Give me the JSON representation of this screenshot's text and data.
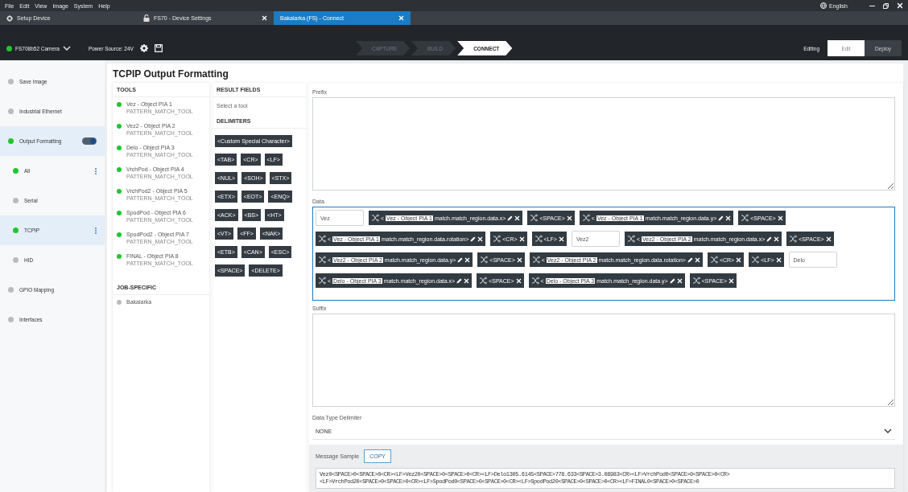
{
  "menu_bar": {
    "items": [
      "File",
      "Edit",
      "View",
      "Image",
      "System",
      "Help"
    ],
    "language": "English"
  },
  "tabs": [
    {
      "label": "Setup Device",
      "kind": "home",
      "closable": false,
      "selected": false
    },
    {
      "label": "FS70 - Device Settings",
      "kind": "lock",
      "closable": true,
      "selected": false
    },
    {
      "label": "Bakalarka (FS) - Connect",
      "kind": "plain",
      "closable": true,
      "selected": true
    }
  ],
  "toolbar": {
    "camera": "FS708b52 Camera",
    "power": "Power Source: 24V",
    "steps": [
      {
        "label": "CAPTURE",
        "selected": false
      },
      {
        "label": "BUILD",
        "selected": false
      },
      {
        "label": "CONNECT",
        "selected": true
      }
    ],
    "mode_label": "Editing",
    "modes": [
      {
        "label": "Edit",
        "selected": true
      },
      {
        "label": "Deploy",
        "selected": false
      }
    ]
  },
  "sidebar": {
    "items": [
      {
        "label": "Save Image",
        "color": "#b8bcc0",
        "selected": false
      },
      {
        "label": "Industrial Ethernet",
        "color": "#b8bcc0",
        "selected": false
      },
      {
        "label": "Output Formatting",
        "color": "#22c52e",
        "selected": true,
        "on": true,
        "children": [
          {
            "label": "All",
            "color": "#22c52e",
            "selected": false,
            "has_menu": true
          },
          {
            "label": "Serial",
            "color": "#b8bcc0",
            "selected": false,
            "has_menu": false
          },
          {
            "label": "TCPIP",
            "color": "#22c52e",
            "selected": true,
            "has_menu": true
          },
          {
            "label": "HID",
            "color": "#b8bcc0",
            "selected": false,
            "has_menu": false
          }
        ]
      },
      {
        "label": "GPIO Mapping",
        "color": "#b8bcc0",
        "selected": false
      },
      {
        "label": "Interfaces",
        "color": "#b8bcc0",
        "selected": false
      }
    ]
  },
  "title": "TCPIP Output Formatting",
  "tools": {
    "heading": "TOOLS",
    "items": [
      {
        "name": "Vez - Object PIA 1",
        "type": "PATTERN_MATCH_TOOL",
        "color": "#22c52e"
      },
      {
        "name": "Vez2 - Object PIA 2",
        "type": "PATTERN_MATCH_TOOL",
        "color": "#22c52e"
      },
      {
        "name": "Delo - Object PIA 3",
        "type": "PATTERN_MATCH_TOOL",
        "color": "#22c52e"
      },
      {
        "name": "VrchPod - Object PIA 4",
        "type": "PATTERN_MATCH_TOOL",
        "color": "#22c52e"
      },
      {
        "name": "VrchPod2 - Object PIA 5",
        "type": "PATTERN_MATCH_TOOL",
        "color": "#22c52e"
      },
      {
        "name": "SpodPod - Object PIA 6",
        "type": "PATTERN_MATCH_TOOL",
        "color": "#22c52e"
      },
      {
        "name": "SpodPod2 - Object PIA 7",
        "type": "PATTERN_MATCH_TOOL",
        "color": "#22c52e"
      },
      {
        "name": "FINAL - Object PIA 8",
        "type": "PATTERN_MATCH_TOOL",
        "color": "#22c52e"
      }
    ],
    "job_heading": "JOB-SPECIFIC",
    "job_items": [
      {
        "name": "Bakalarka",
        "color": "#b8bcc0"
      }
    ]
  },
  "result_fields": {
    "heading": "RESULT FIELDS",
    "hint": "Select a tool",
    "delimiters_heading": "DELIMITERS",
    "delimiters": [
      [
        "<Custom Special Character>"
      ],
      [
        "<TAB>",
        "<CR>",
        "<LF>"
      ],
      [
        "<NUL>",
        "<SOH>",
        "<STX>"
      ],
      [
        "<ETX>",
        "<EOT>",
        "<ENQ>"
      ],
      [
        "<ACK>",
        "<BS>",
        "<HT>"
      ],
      [
        "<VT>",
        "<FF>",
        "<NAK>"
      ],
      [
        "<ETB>",
        "<CAN>",
        "<ESC>"
      ],
      [
        "<SPACE>",
        "<DELETE>"
      ]
    ]
  },
  "prefix": {
    "label": "Prefix"
  },
  "data": {
    "label": "Data",
    "lines": [
      [
        {
          "kind": "text",
          "value": "Vez"
        },
        {
          "kind": "field",
          "open": "<",
          "tool": "Vez - Object PIA 1",
          "path": "match.match_region.data.x>"
        },
        {
          "kind": "delim",
          "label": "<SPACE>"
        },
        {
          "kind": "field",
          "open": "<",
          "tool": "Vez - Object PIA 1",
          "path": "match.match_region.data.y>"
        },
        {
          "kind": "delim",
          "label": "<SPACE>"
        }
      ],
      [
        {
          "kind": "field",
          "open": "<",
          "tool": "Vez - Object PIA 1",
          "path": "match.match_region.data.rotation>"
        },
        {
          "kind": "delim",
          "label": "<CR>"
        },
        {
          "kind": "delim",
          "label": "<LF>"
        },
        {
          "kind": "text",
          "value": "Vez2"
        },
        {
          "kind": "field",
          "open": "<",
          "tool": "Vez2 - Object PIA 2",
          "path": "match.match_region.data.x>"
        },
        {
          "kind": "delim",
          "label": "<SPACE>"
        }
      ],
      [
        {
          "kind": "field",
          "open": "<",
          "tool": "Vez2 - Object PIA 2",
          "path": "match.match_region.data.y>"
        },
        {
          "kind": "delim",
          "label": "<SPACE>"
        },
        {
          "kind": "field",
          "open": "<",
          "tool": "Vez2 - Object PIA 2",
          "path": "match.match_region.data.rotation>"
        },
        {
          "kind": "delim",
          "label": "<CR>"
        },
        {
          "kind": "delim",
          "label": "<LF>"
        },
        {
          "kind": "text",
          "value": "Delo"
        }
      ],
      [
        {
          "kind": "field",
          "open": "<",
          "tool": "Delo - Object PIA 3",
          "path": "match.match_region.data.x>"
        },
        {
          "kind": "delim",
          "label": "<SPACE>"
        },
        {
          "kind": "field",
          "open": "<",
          "tool": "Delo - Object PIA 3",
          "path": "match.match_region.data.y>"
        },
        {
          "kind": "delim",
          "label": "<SPACE>"
        }
      ]
    ]
  },
  "suffix": {
    "label": "Suffix"
  },
  "delimiter_select": {
    "label": "Data Type Delimiter",
    "value": "NONE"
  },
  "message_sample": {
    "label": "Message Sample",
    "button": "COPY",
    "lines": [
      "Vez0<SPACE>0<SPACE>0<CR><LF>Vez20<SPACE>0<SPACE>0<CR><LF>Delo1305.6145<SPACE>778.633<SPACE>3.08983<CR><LF>VrchPod0<SPACE>0<SPACE>0<CR>",
      "<LF>VrchPod20<SPACE>0<SPACE>0<CR><LF>SpodPod0<SPACE>0<SPACE>0<CR><LF>SpodPod20<SPACE>0<SPACE>0<CR><LF>FINAL0<SPACE>0<SPACE>0"
    ]
  }
}
